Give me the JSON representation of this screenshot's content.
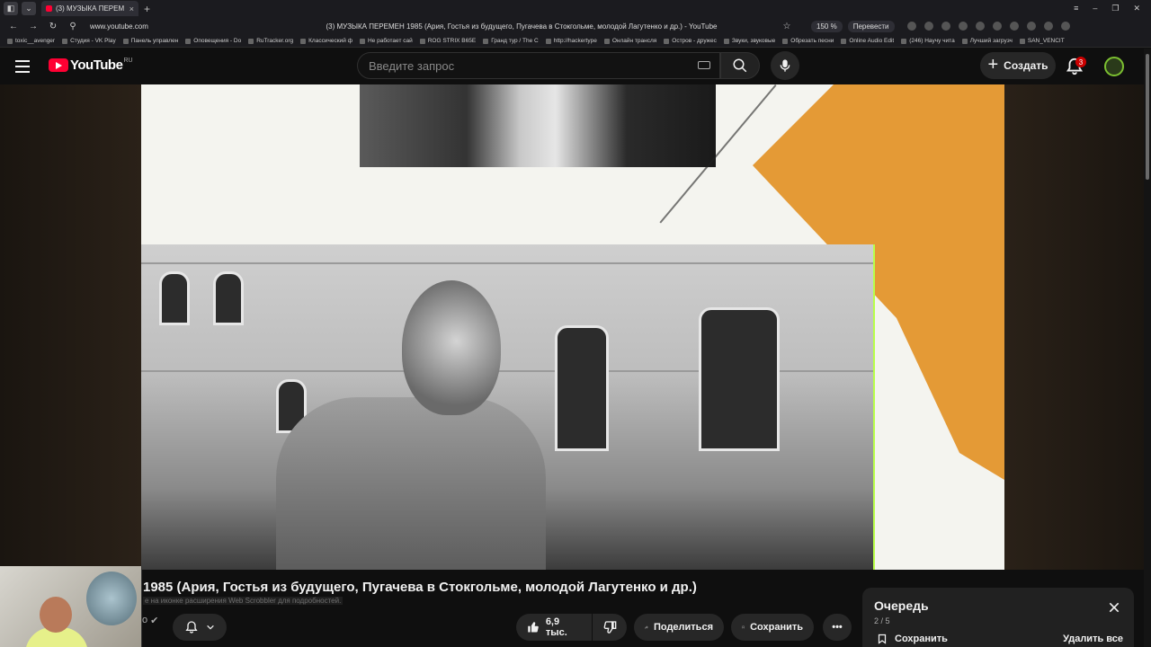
{
  "browser": {
    "tab_title": "(3) МУЗЫКА ПЕРЕМ",
    "url": "www.youtube.com",
    "page_title": "(3) МУЗЫКА ПЕРЕМЕН 1985 (Ария, Гостья из будущего, Пугачева в Стокгольме, молодой Лагутенко и др.) - YouTube",
    "zoom": "150 %",
    "translate": "Перевести"
  },
  "bookmarks": [
    "toxic__avenger",
    "Студия - VK Play",
    "Панель управлен",
    "Оповещения - Do",
    "RuTracker.org",
    "Классический ф",
    "Не работает сай",
    "ROG STRIX B65E",
    "Гранд тур / The C",
    "http://hackertype",
    "Онлайн трансля",
    "Остров - дружес",
    "Звуки, звуковые",
    "Обрезать песни",
    "Online Audio Edit",
    "(246) Научу чита",
    "Лучший загрузч",
    "SAN_VENCIT"
  ],
  "youtube": {
    "logo_text": "YouTube",
    "country_code": "RU",
    "search_placeholder": "Введите запрос",
    "create_label": "Создать",
    "notification_count": "3"
  },
  "video": {
    "title": "1985 (Ария, Гостья из будущего, Пугачева в Стокгольме, молодой Лагутенко и др.)",
    "scrobbler_notice": "е на иконке расширения Web Scrobbler для подробностей.",
    "channel_fragment": "о",
    "likes": "6,9 тыс.",
    "share_label": "Поделиться",
    "save_label": "Сохранить"
  },
  "queue": {
    "title": "Очередь",
    "position": "2 / 5",
    "save_label": "Сохранить",
    "remove_all_label": "Удалить все"
  },
  "colors": {
    "accent_red": "#ff0033",
    "orange_art": "#e49a36",
    "avatar_ring": "#7cc031"
  }
}
